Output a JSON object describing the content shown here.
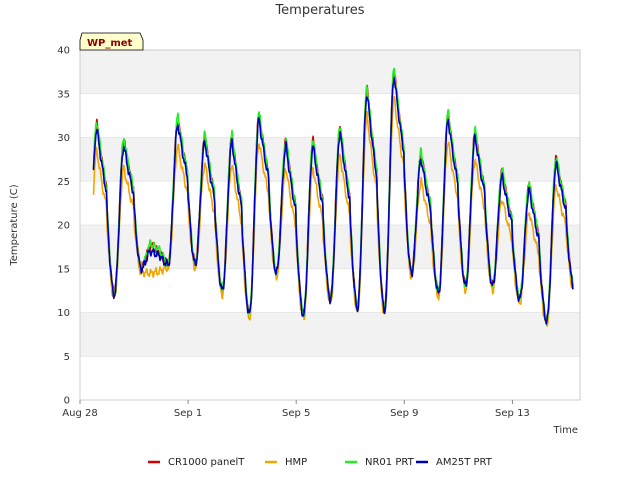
{
  "chart_data": {
    "type": "line",
    "title": "Temperatures",
    "xlabel": "Time",
    "ylabel": "Temperature (C)",
    "tag": "WP_met",
    "ylim": [
      0,
      40
    ],
    "yticks": [
      0,
      5,
      10,
      15,
      20,
      25,
      30,
      35,
      40
    ],
    "xlim": [
      "2023-08-28",
      "2023-09-15"
    ],
    "xticks": [
      {
        "label": "Aug 28",
        "date": "2023-08-28"
      },
      {
        "label": "Sep 1",
        "date": "2023-09-01"
      },
      {
        "label": "Sep 5",
        "date": "2023-09-05"
      },
      {
        "label": "Sep 9",
        "date": "2023-09-09"
      },
      {
        "label": "Sep 13",
        "date": "2023-09-13"
      }
    ],
    "legend_position": "bottom",
    "grid": "alternating horizontal bands",
    "daily_min_max": [
      {
        "date": "2023-08-28",
        "min": 12.5,
        "max": 31
      },
      {
        "date": "2023-08-29",
        "min": 12.0,
        "max": 29
      },
      {
        "date": "2023-08-30",
        "min": 15.0,
        "max": 17
      },
      {
        "date": "2023-08-31",
        "min": 15.5,
        "max": 31.5
      },
      {
        "date": "2023-09-01",
        "min": 15.5,
        "max": 29.5
      },
      {
        "date": "2023-09-02",
        "min": 12.5,
        "max": 29.5
      },
      {
        "date": "2023-09-03",
        "min": 9.8,
        "max": 32
      },
      {
        "date": "2023-09-04",
        "min": 14.5,
        "max": 29
      },
      {
        "date": "2023-09-05",
        "min": 9.7,
        "max": 29
      },
      {
        "date": "2023-09-06",
        "min": 11.5,
        "max": 30.5
      },
      {
        "date": "2023-09-07",
        "min": 10.5,
        "max": 35
      },
      {
        "date": "2023-09-08",
        "min": 10.2,
        "max": 37
      },
      {
        "date": "2023-09-09",
        "min": 14.5,
        "max": 27.5
      },
      {
        "date": "2023-09-10",
        "min": 12.2,
        "max": 32
      },
      {
        "date": "2023-09-11",
        "min": 13.0,
        "max": 30
      },
      {
        "date": "2023-09-12",
        "min": 13.0,
        "max": 25.5
      },
      {
        "date": "2023-09-13",
        "min": 11.5,
        "max": 24
      },
      {
        "date": "2023-09-14",
        "min": 9.0,
        "max": 27
      },
      {
        "date": "2023-09-15",
        "min": 13.0,
        "max": 13.0
      }
    ],
    "series": [
      {
        "name": "CR1000 panelT",
        "color": "#d40000",
        "max_offset": 0.6,
        "min_offset": 0.1
      },
      {
        "name": "HMP",
        "color": "#f0a500",
        "max_offset": -2.5,
        "min_offset": -0.4
      },
      {
        "name": "NR01 PRT",
        "color": "#22ee22",
        "max_offset": 0.9,
        "min_offset": 0.2
      },
      {
        "name": "AM25T PRT",
        "color": "#0000bb",
        "max_offset": 0.0,
        "min_offset": 0.0
      }
    ]
  }
}
